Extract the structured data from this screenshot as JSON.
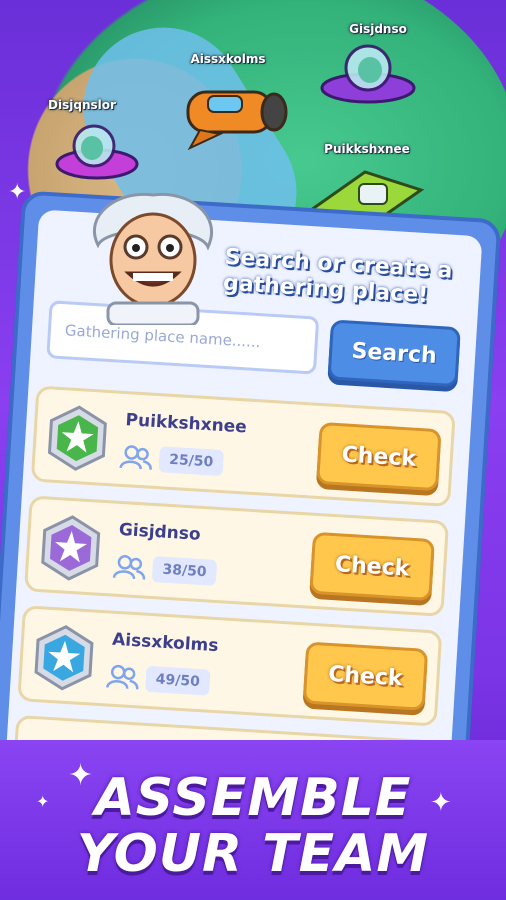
{
  "map": {
    "ships": [
      {
        "name": "Gisjdnso",
        "color": "#8f3fd9"
      },
      {
        "name": "Aissxkolms",
        "color": "#f08a24"
      },
      {
        "name": "Disjqnslor",
        "color": "#c43fd9"
      },
      {
        "name": "Puikkshxnee",
        "color": "#9bd83a"
      }
    ]
  },
  "panel": {
    "title": "Search or create a gathering place!",
    "search_placeholder": "Gathering place name......",
    "search_button": "Search"
  },
  "rows": [
    {
      "name": "Puikkshxnee",
      "count": "25/50",
      "button": "Check",
      "badge_color": "#48b64a",
      "badge_icon": "star-burst-icon"
    },
    {
      "name": "Gisjdnso",
      "count": "38/50",
      "button": "Check",
      "badge_color": "#9b6ad8",
      "badge_icon": "star-burst-icon"
    },
    {
      "name": "Aissxkolms",
      "count": "49/50",
      "button": "Check",
      "badge_color": "#39a8e0",
      "badge_icon": "star-burst-icon"
    }
  ],
  "footer": {
    "line1": "ASSEMBLE",
    "line2": "YOUR TEAM"
  },
  "colors": {
    "accent_purple": "#7b34e6",
    "panel_blue": "#5f8ee8",
    "check_yellow": "#ffc84d"
  }
}
